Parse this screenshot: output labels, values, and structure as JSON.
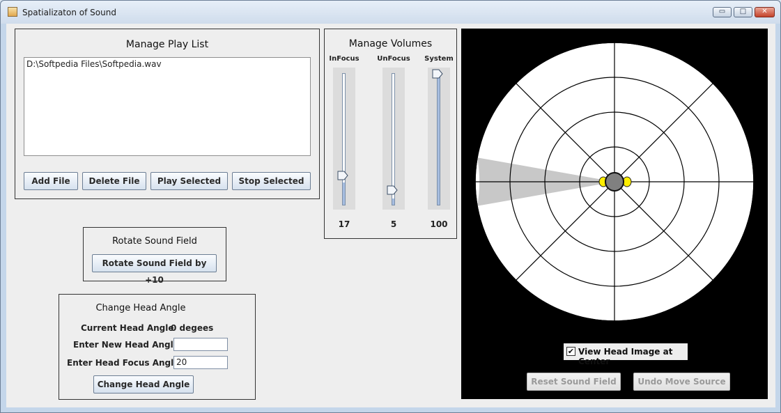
{
  "window": {
    "title": "Spatializaton of Sound"
  },
  "titlebar_buttons": {
    "minimize": "▭",
    "maximize": "□",
    "close": "✕"
  },
  "playlist": {
    "title": "Manage Play List",
    "items": [
      "D:\\Softpedia Files\\Softpedia.wav"
    ],
    "buttons": {
      "add": "Add File",
      "delete": "Delete File",
      "play": "Play Selected",
      "stop": "Stop Selected"
    }
  },
  "volumes": {
    "title": "Manage Volumes",
    "sliders": [
      {
        "label": "InFocus",
        "value": 17,
        "value_text": "17"
      },
      {
        "label": "UnFocus",
        "value": 5,
        "value_text": "5"
      },
      {
        "label": "System",
        "value": 100,
        "value_text": "100"
      }
    ],
    "max": 100
  },
  "rotate": {
    "title": "Rotate Sound Field",
    "button": "Rotate Sound Field by +10"
  },
  "head_angle": {
    "title": "Change Head Angle",
    "current_label": "Current Head Angle",
    "current_value": "0 degees",
    "new_label": "Enter New Head Angle",
    "new_value": "",
    "focus_label": "Enter Head Focus Angle",
    "focus_value": "20",
    "button": "Change Head Angle"
  },
  "sound_field": {
    "view_head_label": "View Head Image at Center",
    "view_head_checked": true,
    "check_glyph": "✔",
    "reset_button": "Reset Sound Field",
    "undo_button": "Undo Move Source",
    "rings": 4,
    "spokes_deg": [
      0,
      45,
      90,
      135
    ],
    "focus_direction_deg": 180,
    "focus_angle_deg": 20,
    "colors": {
      "background": "#000000",
      "field": "#ffffff",
      "lines": "#000000",
      "focus": "#c8c8c8",
      "head": "#808080",
      "ears": "#ffee00"
    }
  }
}
